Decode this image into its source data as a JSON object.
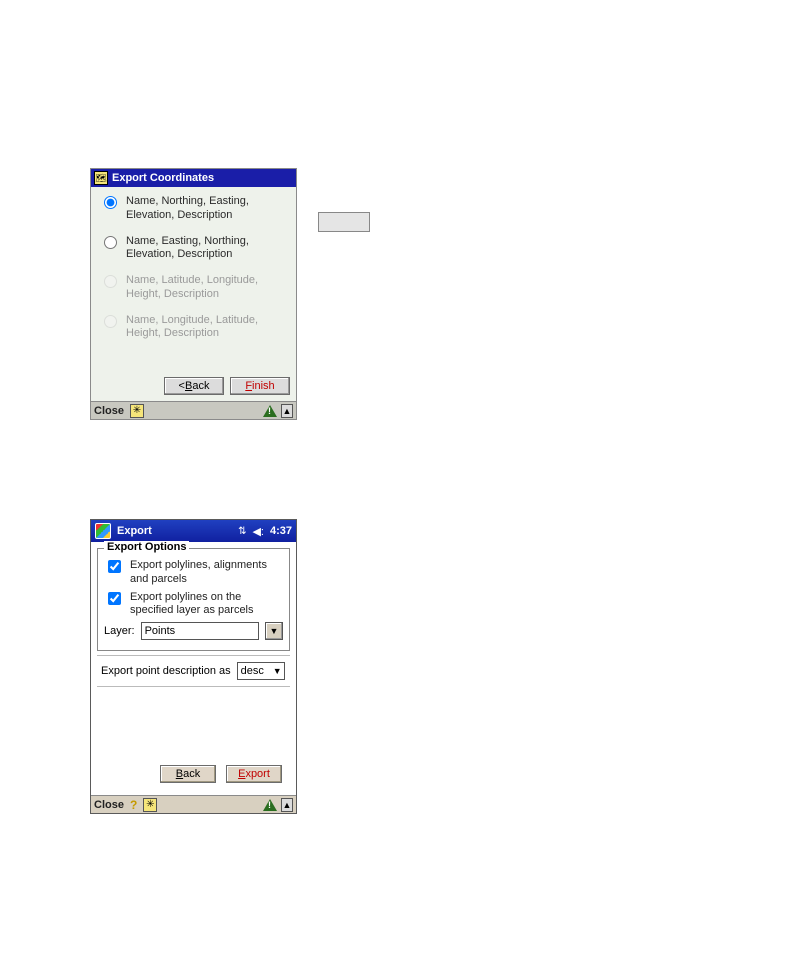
{
  "placeholder": "",
  "dlg1": {
    "title": "Export Coordinates",
    "app_icon_glyph": "🗺",
    "radios": [
      {
        "label": "Name, Northing, Easting, Elevation, Description",
        "checked": true,
        "disabled": false
      },
      {
        "label": "Name, Easting, Northing, Elevation, Description",
        "checked": false,
        "disabled": false
      },
      {
        "label": "Name, Latitude, Longitude, Height, Description",
        "checked": false,
        "disabled": true
      },
      {
        "label": "Name, Longitude, Latitude, Height, Description",
        "checked": false,
        "disabled": true
      }
    ],
    "back_prefix": "< ",
    "back_letter": "B",
    "back_rest": "ack",
    "finish_letter": "F",
    "finish_rest": "inish",
    "close": "Close",
    "star": "✳",
    "sip": "▲"
  },
  "dlg2": {
    "title": "Export",
    "time": "4:37",
    "sync_glyph": "⇅",
    "vol_glyph": "◀:",
    "group_legend": "Export Options",
    "chk1": "Export polylines, alignments and parcels",
    "chk2": "Export polylines on the specified layer as parcels",
    "layer_label": "Layer:",
    "layer_value": "Points",
    "desc_label": "Export point description as",
    "desc_value": "desc",
    "back_letter": "B",
    "back_rest": "ack",
    "export_letter": "E",
    "export_rest": "xport",
    "close": "Close",
    "help": "?",
    "star": "✳",
    "sip": "▲"
  }
}
